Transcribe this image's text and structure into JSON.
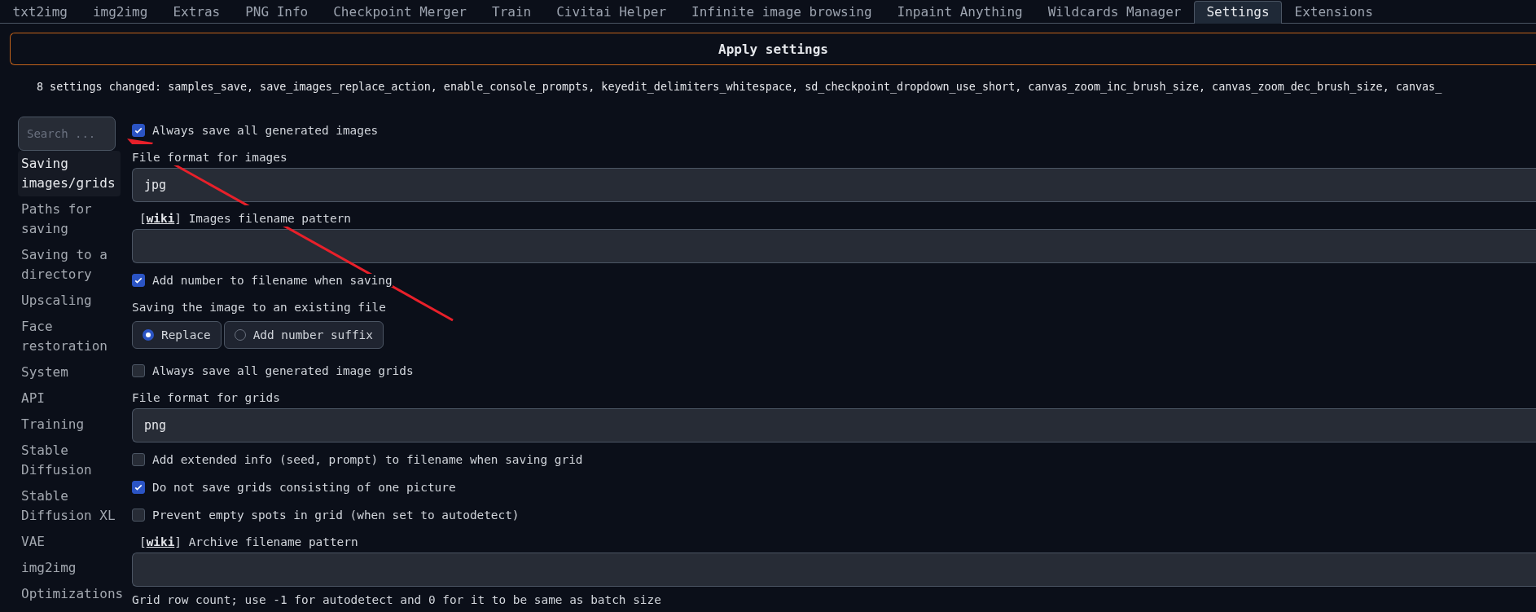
{
  "tabs": [
    {
      "label": "txt2img",
      "selected": false
    },
    {
      "label": "img2img",
      "selected": false
    },
    {
      "label": "Extras",
      "selected": false
    },
    {
      "label": "PNG Info",
      "selected": false
    },
    {
      "label": "Checkpoint Merger",
      "selected": false
    },
    {
      "label": "Train",
      "selected": false
    },
    {
      "label": "Civitai Helper",
      "selected": false
    },
    {
      "label": "Infinite image browsing",
      "selected": false
    },
    {
      "label": "Inpaint Anything",
      "selected": false
    },
    {
      "label": "Wildcards Manager",
      "selected": false
    },
    {
      "label": "Settings",
      "selected": true
    },
    {
      "label": "Extensions",
      "selected": false
    }
  ],
  "apply_button": "Apply settings",
  "changed_notice": "8 settings changed: samples_save, save_images_replace_action, enable_console_prompts, keyedit_delimiters_whitespace, sd_checkpoint_dropdown_use_short, canvas_zoom_inc_brush_size, canvas_zoom_dec_brush_size, canvas_",
  "sidebar": {
    "search": {
      "placeholder": "Search ..."
    },
    "items": [
      {
        "label": "Saving images/grids",
        "selected": true
      },
      {
        "label": "Paths for saving",
        "selected": false
      },
      {
        "label": "Saving to a directory",
        "selected": false
      },
      {
        "label": "Upscaling",
        "selected": false
      },
      {
        "label": "Face restoration",
        "selected": false
      },
      {
        "label": "System",
        "selected": false
      },
      {
        "label": "API",
        "selected": false
      },
      {
        "label": "Training",
        "selected": false
      },
      {
        "label": "Stable Diffusion",
        "selected": false
      },
      {
        "label": "Stable Diffusion XL",
        "selected": false
      },
      {
        "label": "VAE",
        "selected": false
      },
      {
        "label": "img2img",
        "selected": false
      },
      {
        "label": "Optimizations",
        "selected": false
      }
    ]
  },
  "settings": [
    {
      "kind": "checkbox",
      "label": "Always save all generated images",
      "checked": true
    },
    {
      "kind": "field",
      "label": "File format for images",
      "value": "jpg"
    },
    {
      "kind": "field",
      "label_before": "[",
      "link": "wiki",
      "label": "] Images filename pattern"
    },
    {
      "kind": "checkbox",
      "label": "Add number to filename when saving",
      "checked": true
    },
    {
      "kind": "radio",
      "label": "Saving the image to an existing file",
      "options": [
        {
          "label": "Replace",
          "selected": true
        },
        {
          "label": "Add number suffix",
          "selected": false
        }
      ]
    },
    {
      "kind": "checkbox",
      "label": "Always save all generated image grids",
      "checked": false
    },
    {
      "kind": "field",
      "label": "File format for grids",
      "value": "png"
    },
    {
      "kind": "checkbox",
      "label": "Add extended info (seed, prompt) to filename when saving grid",
      "checked": false
    },
    {
      "kind": "checkbox",
      "label": "Do not save grids consisting of one picture",
      "checked": true
    },
    {
      "kind": "checkbox",
      "label": "Prevent empty spots in grid (when set to autodetect)",
      "checked": false
    },
    {
      "kind": "field",
      "label_before": "[",
      "link": "wiki",
      "label": "] Archive filename pattern"
    },
    {
      "kind": "text",
      "label": "Grid row count; use -1 for autodetect and 0 for it to be same as batch size"
    }
  ],
  "annotations": [
    {
      "kind": "arrow"
    }
  ]
}
